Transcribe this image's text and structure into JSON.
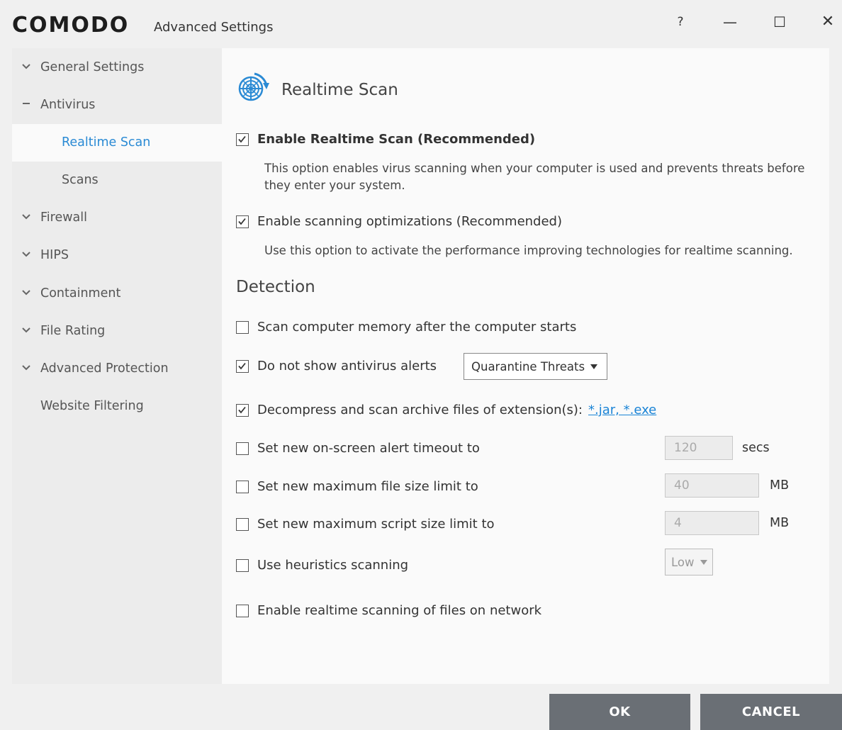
{
  "window": {
    "logo": "COMODO",
    "title": "Advanced Settings",
    "help": "?",
    "minimize": "—",
    "maximize": "☐",
    "close": "✕"
  },
  "sidebar": {
    "items": [
      {
        "label": "General Settings",
        "icon": "chevron-down-icon"
      },
      {
        "label": "Antivirus",
        "icon": "minus-icon"
      },
      {
        "label": "Realtime Scan",
        "active": true
      },
      {
        "label": "Scans"
      },
      {
        "label": "Firewall",
        "icon": "chevron-down-icon"
      },
      {
        "label": "HIPS",
        "icon": "chevron-down-icon"
      },
      {
        "label": "Containment",
        "icon": "chevron-down-icon"
      },
      {
        "label": "File Rating",
        "icon": "chevron-down-icon"
      },
      {
        "label": "Advanced Protection",
        "icon": "chevron-down-icon"
      },
      {
        "label": "Website Filtering"
      }
    ]
  },
  "main": {
    "title": "Realtime Scan",
    "enable_realtime": {
      "label": "Enable Realtime Scan (Recommended)",
      "checked": true,
      "description": "This option enables virus scanning when your computer is used and prevents threats before they enter your system."
    },
    "enable_optimizations": {
      "label": "Enable scanning optimizations (Recommended)",
      "checked": true,
      "description": "Use this option to activate the performance improving technologies for realtime scanning."
    },
    "detection_heading": "Detection",
    "scan_memory": {
      "label": "Scan computer memory after the computer starts",
      "checked": false
    },
    "no_alerts": {
      "label": "Do not show antivirus alerts",
      "checked": true,
      "dropdown": "Quarantine Threats"
    },
    "decompress": {
      "label": "Decompress and scan archive files of extension(s):",
      "checked": true,
      "link": "*.jar, *.exe"
    },
    "alert_timeout": {
      "label": "Set new on-screen alert timeout to",
      "checked": false,
      "value": "120",
      "unit": "secs"
    },
    "max_file_size": {
      "label": "Set new maximum file size limit to",
      "checked": false,
      "value": "40",
      "unit": "MB"
    },
    "max_script_size": {
      "label": "Set new maximum script size limit to",
      "checked": false,
      "value": "4",
      "unit": "MB"
    },
    "heuristics": {
      "label": "Use heuristics scanning",
      "checked": false,
      "dropdown": "Low"
    },
    "network_scan": {
      "label": "Enable realtime scanning of files on network",
      "checked": false
    }
  },
  "footer": {
    "ok": "OK",
    "cancel": "CANCEL"
  },
  "colors": {
    "accent": "#2a8ad4",
    "link": "#1a84d6",
    "button": "#6a6f75"
  }
}
